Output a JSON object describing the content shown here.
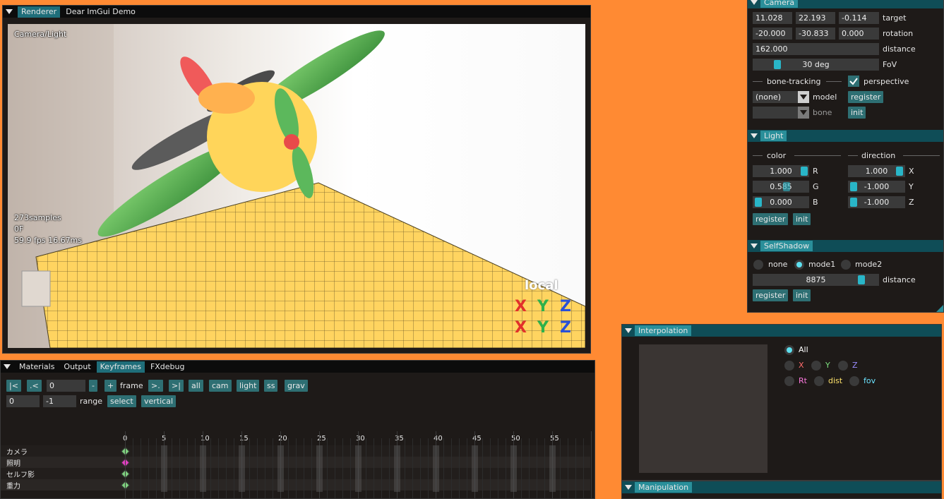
{
  "renderer": {
    "tabs": [
      "Renderer",
      "Dear ImGui Demo"
    ],
    "overlay_title": "Camera/Light",
    "samples": "273samples",
    "frame": "0F",
    "fps": "59.9 fps 16.67ms",
    "gizmo_label": "local",
    "gizmo_axes": [
      "X",
      "Y",
      "Z"
    ]
  },
  "camera": {
    "header": "Camera",
    "target": [
      "11.028",
      "22.193",
      "-0.114"
    ],
    "target_label": "target",
    "rotation": [
      "-20.000",
      "-30.833",
      "0.000"
    ],
    "rotation_label": "rotation",
    "distance": "162.000",
    "distance_label": "distance",
    "fov": "30 deg",
    "fov_label": "FoV",
    "bone_tracking": "bone-tracking",
    "perspective": "perspective",
    "model_value": "(none)",
    "model_label": "model",
    "bone_label": "bone",
    "register": "register",
    "init": "init"
  },
  "light": {
    "header": "Light",
    "color_label": "color",
    "direction_label": "direction",
    "color": [
      {
        "v": "1.000",
        "c": "R"
      },
      {
        "v": "0.585",
        "c": "G"
      },
      {
        "v": "0.000",
        "c": "B"
      }
    ],
    "direction": [
      {
        "v": "1.000",
        "c": "X"
      },
      {
        "v": "-1.000",
        "c": "Y"
      },
      {
        "v": "-1.000",
        "c": "Z"
      }
    ],
    "register": "register",
    "init": "init"
  },
  "selfshadow": {
    "header": "SelfShadow",
    "modes": [
      "none",
      "mode1",
      "mode2"
    ],
    "selected": "mode1",
    "distance": "8875",
    "distance_label": "distance",
    "register": "register",
    "init": "init"
  },
  "keyframes": {
    "tabs": [
      "Materials",
      "Output",
      "Keyframes",
      "FXdebug"
    ],
    "nav": [
      "|<",
      ".<",
      "-",
      "+",
      ">.",
      ">|"
    ],
    "frame_value": "0",
    "frame_label": "frame",
    "filters": [
      "all",
      "cam",
      "light",
      "ss",
      "grav"
    ],
    "range_start": "0",
    "range_end": "-1",
    "range_label": "range",
    "select": "select",
    "vertical": "vertical",
    "ruler": [
      "0",
      "5",
      "10",
      "15",
      "20",
      "25",
      "30",
      "35",
      "40",
      "45",
      "50",
      "55"
    ],
    "tracks": [
      "カメラ",
      "照明",
      "セルフ影",
      "重力"
    ]
  },
  "interpolation": {
    "header": "Interpolation",
    "options": [
      {
        "label": "All",
        "color": "#ffffff",
        "on": true
      },
      {
        "label": "X",
        "color": "#ff6b6b",
        "on": false
      },
      {
        "label": "Y",
        "color": "#7ee07e",
        "on": false
      },
      {
        "label": "Z",
        "color": "#9a8cff",
        "on": false
      },
      {
        "label": "Rt",
        "color": "#ff7ae0",
        "on": false
      },
      {
        "label": "dist",
        "color": "#ffe36b",
        "on": false
      },
      {
        "label": "fov",
        "color": "#6be3ff",
        "on": false
      }
    ]
  },
  "manipulation": {
    "header": "Manipulation"
  },
  "colors": {
    "accent": "#29b6c8",
    "tab_active": "#1f6e7a",
    "header": "#0f4d57",
    "background": "#ff8a33"
  }
}
